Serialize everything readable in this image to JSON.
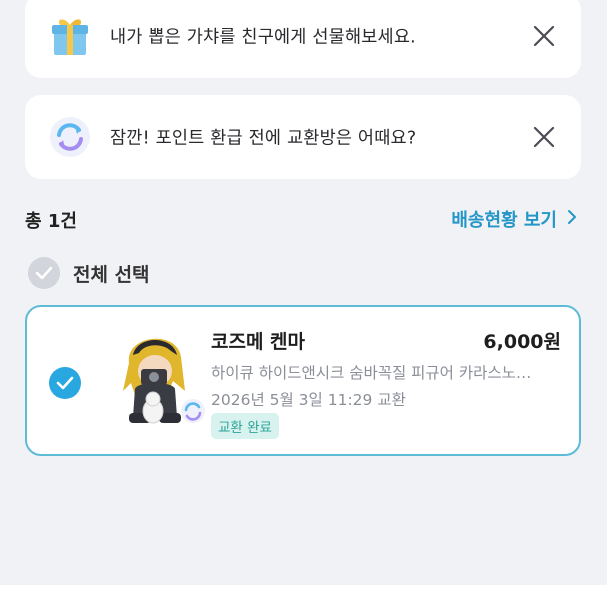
{
  "notices": [
    {
      "icon": "gift-icon",
      "text": "내가 뽑은 가챠를 친구에게 선물해보세요.",
      "close_icon": "close-icon"
    },
    {
      "icon": "exchange-icon",
      "text": "잠깐! 포인트 환급 전에 교환방은 어때요?",
      "close_icon": "close-icon"
    }
  ],
  "summary": {
    "count_label": "총 1건",
    "tracking_link": "배송현황 보기"
  },
  "select_all": {
    "label": "전체 선택",
    "checked": false
  },
  "items": [
    {
      "name": "코즈메 켄마",
      "price": "6,000원",
      "description": "하이큐 하이드앤시크 숨바꼭질 피규어 카라스노…",
      "date": "2026년 5월 3일 11:29 교환",
      "badge": "교환 완료",
      "checked": true
    }
  ],
  "colors": {
    "accent": "#29a7e0",
    "link": "#2596c8",
    "card_border": "#5dbbd6",
    "badge_bg": "#d7f2ef",
    "badge_text": "#2ea497",
    "background": "#f1f2f6"
  }
}
